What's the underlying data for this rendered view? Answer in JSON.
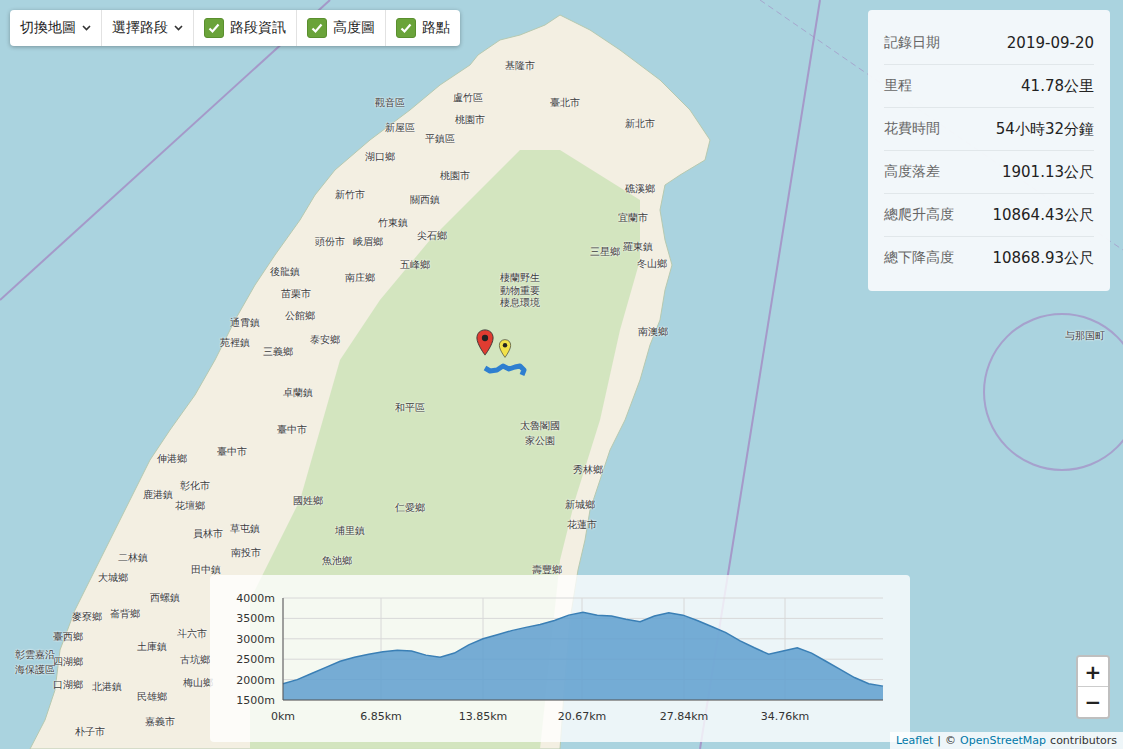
{
  "toolbar": {
    "dropdowns": [
      {
        "label": "切換地圖"
      },
      {
        "label": "選擇路段"
      }
    ],
    "toggles": [
      {
        "label": "路段資訊",
        "checked": true
      },
      {
        "label": "高度圖",
        "checked": true
      },
      {
        "label": "路點",
        "checked": true
      }
    ]
  },
  "info_panel": {
    "rows": [
      {
        "label": "記錄日期",
        "value": "2019-09-20"
      },
      {
        "label": "里程",
        "value": "41.78公里"
      },
      {
        "label": "花費時間",
        "value": "54小時32分鐘"
      },
      {
        "label": "高度落差",
        "value": "1901.13公尺"
      },
      {
        "label": "總爬升高度",
        "value": "10864.43公尺"
      },
      {
        "label": "總下降高度",
        "value": "10868.93公尺"
      }
    ]
  },
  "map": {
    "labels": [
      "基隆市",
      "臺北市",
      "新北市",
      "盧竹區",
      "桃園市",
      "觀音區",
      "新屋區",
      "平鎮區",
      "湖口鄉",
      "桃園市",
      "新竹市",
      "關西鎮",
      "竹東鎮",
      "尖石鄉",
      "頭份市",
      "峨眉鄉",
      "礁溪鄉",
      "宜蘭市",
      "三星鄉",
      "羅東鎮",
      "冬山鄉",
      "五峰鄉",
      "南庄鄉",
      "後龍鎮",
      "苗栗市",
      "公館鄉",
      "棲蘭野生",
      "動物重要",
      "棲息環境",
      "通霄鎮",
      "泰安鄉",
      "苑裡鎮",
      "三義鄉",
      "南澳鄉",
      "与那国町",
      "卓蘭鎮",
      "和平區",
      "太魯閣國",
      "家公園",
      "臺中市",
      "臺中市",
      "伸港鄉",
      "彰化市",
      "鹿港鎮",
      "花壇鄉",
      "秀林鄉",
      "國姓鄉",
      "仁愛鄉",
      "新城鄉",
      "花蓮市",
      "員林市",
      "草屯鎮",
      "埔里鎮",
      "南投市",
      "二林鎮",
      "魚池鄉",
      "大城鄉",
      "田中鎮",
      "壽豐鄉",
      "西螺鎮",
      "麥寮鄉",
      "崙背鄉",
      "臺西鄉",
      "土庫鎮",
      "斗六市",
      "古坑鄉",
      "四湖鄉",
      "彰雲嘉沿",
      "海保護區",
      "口湖鄉",
      "北港鎮",
      "梅山鄉",
      "民雄鄉",
      "嘉義市",
      "朴子市"
    ],
    "markers": [
      {
        "kind": "start",
        "color": "#e03c31"
      },
      {
        "kind": "end",
        "color": "#f2e24a"
      }
    ]
  },
  "elevation_chart": {
    "y_ticks": [
      "4000m",
      "3500m",
      "3000m",
      "2500m",
      "2000m",
      "1500m"
    ],
    "x_ticks": [
      "0km",
      "6.85km",
      "13.85km",
      "20.67km",
      "27.84km",
      "34.76km"
    ],
    "series": [
      {
        "name": "elevation",
        "values": [
          1900,
          2000,
          2150,
          2300,
          2450,
          2550,
          2620,
          2680,
          2720,
          2700,
          2600,
          2550,
          2650,
          2850,
          3000,
          3100,
          3200,
          3280,
          3350,
          3450,
          3580,
          3650,
          3580,
          3560,
          3480,
          3420,
          3560,
          3640,
          3580,
          3450,
          3300,
          3150,
          2950,
          2780,
          2620,
          2700,
          2780,
          2650,
          2450,
          2250,
          2050,
          1900,
          1840
        ]
      }
    ]
  },
  "zoom": {
    "in": "+",
    "out": "−"
  },
  "attribution": {
    "leaflet": "Leaflet",
    "separator": "|",
    "copyright": "©",
    "osm": "OpenStreetMap",
    "suffix": "contributors"
  }
}
